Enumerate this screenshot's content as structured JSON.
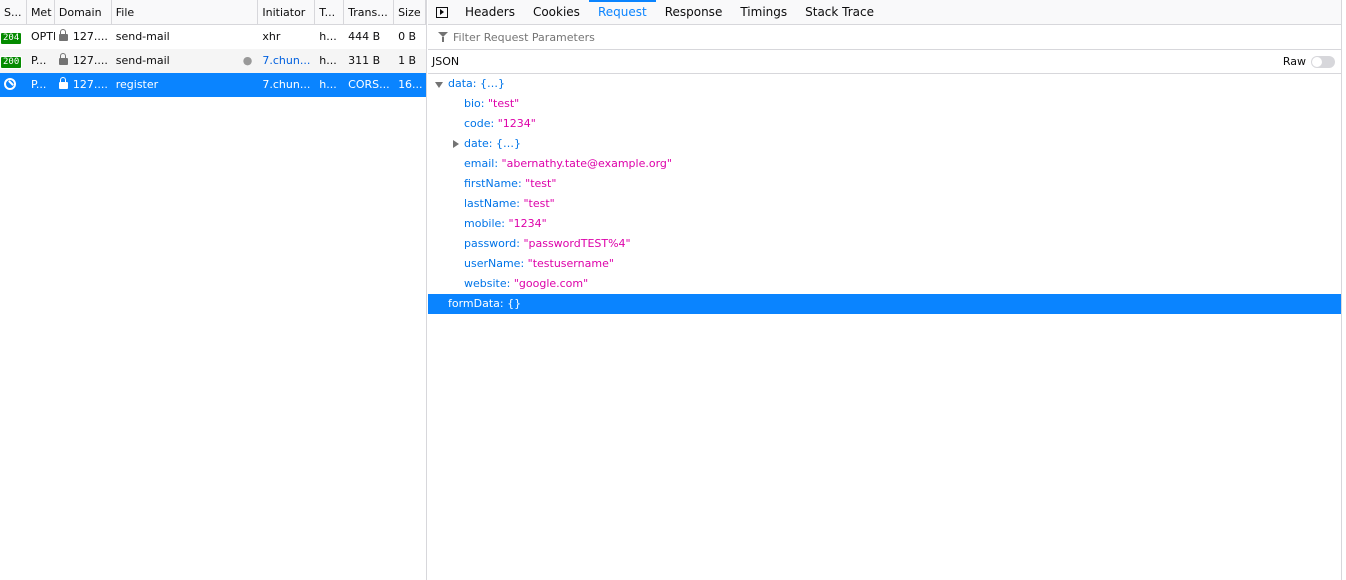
{
  "requests": {
    "columns": [
      "S...",
      "Met",
      "Domain",
      "File",
      "Initiator",
      "T...",
      "Trans...",
      "Size"
    ],
    "rows": [
      {
        "status": "204",
        "method": "OPTI",
        "domain": "127....",
        "file": "send-mail",
        "initiator": "xhr",
        "type": "h...",
        "transferred": "444 B",
        "size": "0 B"
      },
      {
        "status": "200",
        "method": "P...",
        "domain": "127....",
        "file": "send-mail",
        "initiator": "7.chun...",
        "type": "h...",
        "transferred": "311 B",
        "size": "1 B"
      },
      {
        "status": "",
        "method": "P...",
        "domain": "127....",
        "file": "register",
        "initiator": "7.chun...",
        "type": "h...",
        "transferred": "CORS...",
        "size": "16..."
      }
    ]
  },
  "details": {
    "tabs": [
      "Headers",
      "Cookies",
      "Request",
      "Response",
      "Timings",
      "Stack Trace"
    ],
    "selected_tab": "Request",
    "filter_placeholder": "Filter Request Parameters",
    "section_label": "JSON",
    "raw_label": "Raw",
    "tree": {
      "data_key": "data:",
      "data_val": "{…}",
      "fields": [
        {
          "key": "bio:",
          "value": "\"test\""
        },
        {
          "key": "code:",
          "value": "\"1234\""
        },
        {
          "key": "date:",
          "value": "{…}"
        },
        {
          "key": "email:",
          "value": "\"abernathy.tate@example.org\""
        },
        {
          "key": "firstName:",
          "value": "\"test\""
        },
        {
          "key": "lastName:",
          "value": "\"test\""
        },
        {
          "key": "mobile:",
          "value": "\"1234\""
        },
        {
          "key": "password:",
          "value": "\"passwordTEST%4\""
        },
        {
          "key": "userName:",
          "value": "\"testusername\""
        },
        {
          "key": "website:",
          "value": "\"google.com\""
        }
      ],
      "form_key": "formData:",
      "form_val": "{}"
    }
  },
  "colors": {
    "accent": "#0a84ff",
    "status_ok": "#058b00",
    "key": "#0074e8",
    "string": "#dd00a9"
  }
}
